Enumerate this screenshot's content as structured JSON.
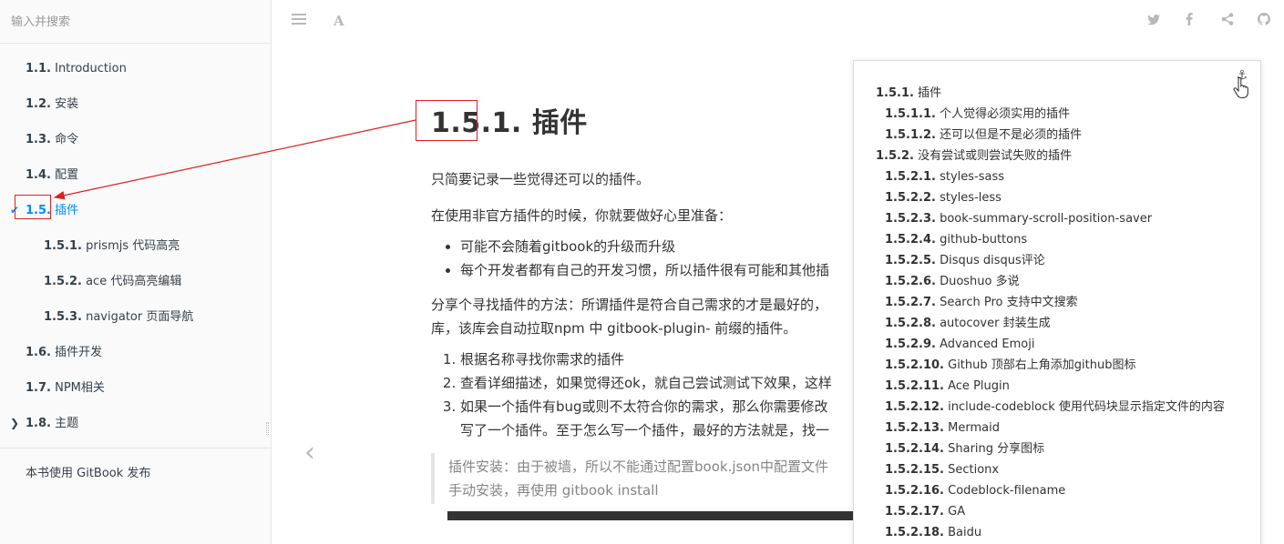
{
  "sidebar": {
    "search_placeholder": "输入并搜索",
    "items": [
      {
        "num": "1.1.",
        "label": "Introduction",
        "level": 1
      },
      {
        "num": "1.2.",
        "label": "安装",
        "level": 1
      },
      {
        "num": "1.3.",
        "label": "命令",
        "level": 1
      },
      {
        "num": "1.4.",
        "label": "配置",
        "level": 1
      },
      {
        "num": "1.5.",
        "label": "插件",
        "level": 1,
        "active": true,
        "chevron": "check-icon"
      },
      {
        "num": "1.5.1.",
        "label": "prismjs 代码高亮",
        "level": 2
      },
      {
        "num": "1.5.2.",
        "label": "ace 代码高亮编辑",
        "level": 2
      },
      {
        "num": "1.5.3.",
        "label": "navigator 页面导航",
        "level": 2
      },
      {
        "num": "1.6.",
        "label": "插件开发",
        "level": 1
      },
      {
        "num": "1.7.",
        "label": "NPM相关",
        "level": 1
      },
      {
        "num": "1.8.",
        "label": "主题",
        "level": 1,
        "chevron": "chevron-right-icon"
      }
    ],
    "publish_label": "本书使用 GitBook 发布"
  },
  "toolbar": {
    "left_icons": [
      "menu-icon",
      "font-icon"
    ],
    "right_icons": [
      "twitter-icon",
      "facebook-icon",
      "share-icon",
      "github-icon"
    ]
  },
  "main": {
    "title": "1.5.1. 插件",
    "para1": "只简要记录一些觉得还可以的插件。",
    "para2": "在使用非官方插件的时候，你就要做好心里准备：",
    "bullets": [
      "可能不会随着gitbook的升级而升级",
      "每个开发者都有自己的开发习惯，所以插件很有可能和其他插"
    ],
    "para3_line1": "分享个寻找插件的方法：所谓插件是符合自己需求的才是最好的，",
    "para3_line2": "库，该库会自动拉取npm 中 gitbook-plugin- 前缀的插件。",
    "steps": [
      "根据名称寻找你需求的插件",
      "查看详细描述，如果觉得还ok，就自己尝试测试下效果，这样",
      "如果一个插件有bug或则不太符合你的需求，那么你需要修改"
    ],
    "step3_line2": "写了一个插件。至于怎么写一个插件，最好的方法就是，找一",
    "quote_line1": "插件安装：由于被墙，所以不能通过配置book.json中配置文件",
    "quote_line2": "手动安装，再使用 gitbook install"
  },
  "navigator": {
    "anchor_icon": "anchor-icon",
    "items": [
      {
        "num": "1.5.1.",
        "label": "插件",
        "level": 1
      },
      {
        "num": "1.5.1.1.",
        "label": "个人觉得必须实用的插件",
        "level": 2
      },
      {
        "num": "1.5.1.2.",
        "label": "还可以但是不是必须的插件",
        "level": 2
      },
      {
        "num": "1.5.2.",
        "label": "没有尝试或则尝试失败的插件",
        "level": 1
      },
      {
        "num": "1.5.2.1.",
        "label": "styles-sass",
        "level": 2
      },
      {
        "num": "1.5.2.2.",
        "label": "styles-less",
        "level": 2
      },
      {
        "num": "1.5.2.3.",
        "label": "book-summary-scroll-position-saver",
        "level": 2
      },
      {
        "num": "1.5.2.4.",
        "label": "github-buttons",
        "level": 2
      },
      {
        "num": "1.5.2.5.",
        "label": "Disqus disqus评论",
        "level": 2
      },
      {
        "num": "1.5.2.6.",
        "label": "Duoshuo 多说",
        "level": 2
      },
      {
        "num": "1.5.2.7.",
        "label": "Search Pro 支持中文搜索",
        "level": 2
      },
      {
        "num": "1.5.2.8.",
        "label": "autocover 封装生成",
        "level": 2
      },
      {
        "num": "1.5.2.9.",
        "label": "Advanced Emoji",
        "level": 2
      },
      {
        "num": "1.5.2.10.",
        "label": "Github 顶部右上角添加github图标",
        "level": 2
      },
      {
        "num": "1.5.2.11.",
        "label": "Ace Plugin",
        "level": 2
      },
      {
        "num": "1.5.2.12.",
        "label": "include-codeblock 使用代码块显示指定文件的内容",
        "level": 2
      },
      {
        "num": "1.5.2.13.",
        "label": "Mermaid",
        "level": 2
      },
      {
        "num": "1.5.2.14.",
        "label": "Sharing 分享图标",
        "level": 2
      },
      {
        "num": "1.5.2.15.",
        "label": "Sectionx",
        "level": 2
      },
      {
        "num": "1.5.2.16.",
        "label": "Codeblock-filename",
        "level": 2
      },
      {
        "num": "1.5.2.17.",
        "label": "GA",
        "level": 2
      },
      {
        "num": "1.5.2.18.",
        "label": "Baidu",
        "level": 2
      }
    ]
  },
  "colors": {
    "active": "#008cff",
    "annotation": "#e02020"
  }
}
